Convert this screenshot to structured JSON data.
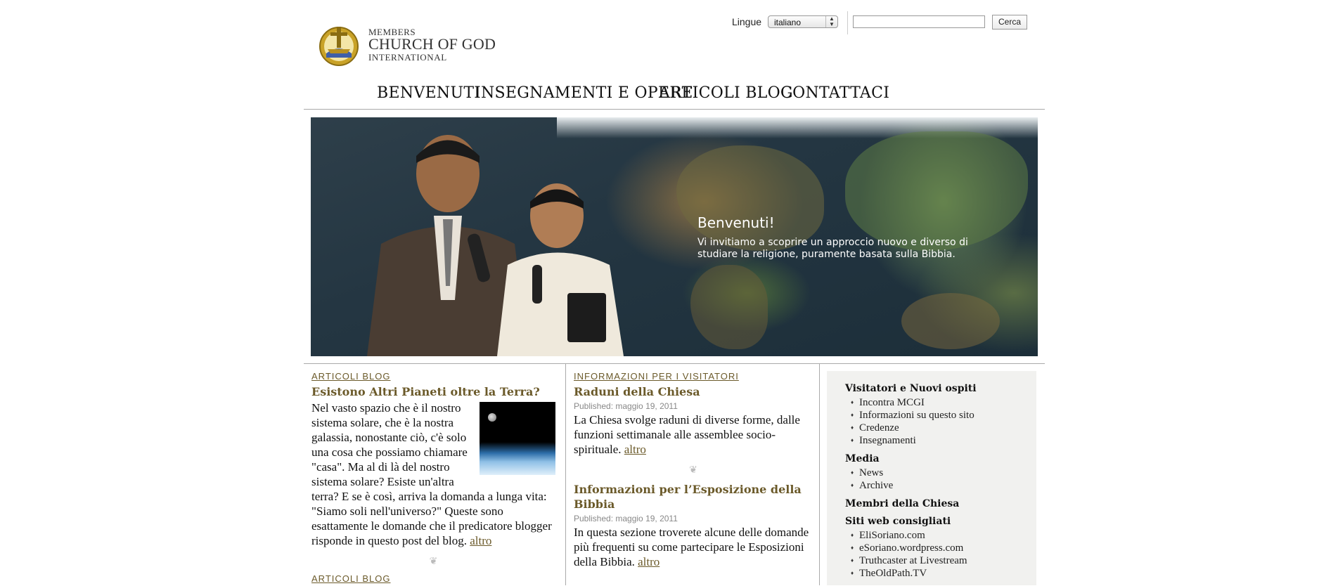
{
  "header": {
    "logo": {
      "line1": "MEMBERS",
      "line2": "CHURCH OF GOD",
      "line3": "INTERNATIONAL"
    },
    "language_label": "Lingue",
    "language_selected": "italiano",
    "search_placeholder": "",
    "search_button": "Cerca"
  },
  "nav": [
    "BENVENUTI",
    "INSEGNAMENTI E OPERE",
    "ARTICOLI BLOG",
    "CONTATTACI"
  ],
  "banner": {
    "title": "Benvenuti!",
    "text": "Vi invitiamo a scoprire un approccio nuovo e diverso di studiare la religione, puramente basata sulla Bibbia."
  },
  "column1": {
    "kicker": "ARTICOLI BLOG",
    "title": "Esistono Altri Pianeti oltre la Terra?",
    "body": "Nel vasto spazio che è il nostro sistema solare, che è la nostra galassia, nonostante ciò, c'è solo una cosa che possiamo chiamare \"casa\". Ma al di là del nostro sistema solare? Esiste un'altra terra? E se è così, arriva la domanda a lunga vita: \"Siamo soli nell'universo?\" Queste sono esattamente le domande che il predicatore blogger risponde in questo post del blog.",
    "more": "altro",
    "kicker2": "ARTICOLI BLOG"
  },
  "column2": {
    "kicker": "INFORMAZIONI PER I VISITATORI",
    "posts": [
      {
        "title": "Raduni della Chiesa",
        "meta": "Published: maggio 19, 2011",
        "body": "La Chiesa svolge raduni di diverse forme, dalle funzioni settimanale alle assemblee socio-spirituale.",
        "more": "altro"
      },
      {
        "title": "Informazioni per l’Esposizione della Bibbia",
        "meta": "Published: maggio 19, 2011",
        "body": "In questa sezione troverete alcune delle domande più frequenti su come partecipare le Esposizioni della Bibbia.",
        "more": "altro"
      }
    ]
  },
  "sidebar": {
    "sections": [
      {
        "heading": "Visitatori e Nuovi ospiti",
        "items": [
          "Incontra MCGI",
          "Informazioni su questo sito",
          "Credenze",
          "Insegnamenti"
        ]
      },
      {
        "heading": "Media",
        "items": [
          "News",
          "Archive"
        ]
      },
      {
        "heading": "Membri della Chiesa",
        "items": []
      },
      {
        "heading": "Siti web consigliati",
        "items": [
          "EliSoriano.com",
          "eSoriano.wordpress.com",
          "Truthcaster at Livestream",
          "TheOldPath.TV"
        ]
      }
    ]
  },
  "colors": {
    "accent": "#6b5a2a",
    "sidebar_bg": "#f1f1ef",
    "rule": "#aaaaaa"
  }
}
